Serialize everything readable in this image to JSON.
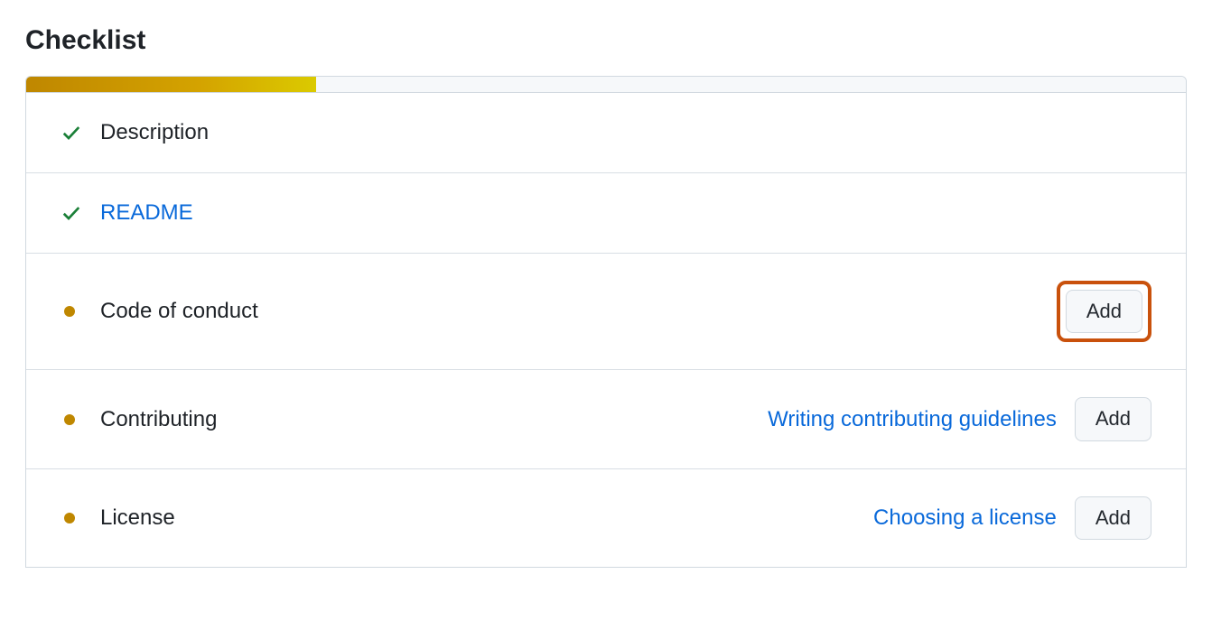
{
  "title": "Checklist",
  "progress_percent": 25,
  "items": [
    {
      "label": "Description",
      "status": "done",
      "is_link": false,
      "hint": null,
      "add_button": null,
      "highlight": false
    },
    {
      "label": "README",
      "status": "done",
      "is_link": true,
      "hint": null,
      "add_button": null,
      "highlight": false
    },
    {
      "label": "Code of conduct",
      "status": "pending",
      "is_link": false,
      "hint": null,
      "add_button": "Add",
      "highlight": true
    },
    {
      "label": "Contributing",
      "status": "pending",
      "is_link": false,
      "hint": "Writing contributing guidelines",
      "add_button": "Add",
      "highlight": false
    },
    {
      "label": "License",
      "status": "pending",
      "is_link": false,
      "hint": "Choosing a license",
      "add_button": "Add",
      "highlight": false
    }
  ]
}
